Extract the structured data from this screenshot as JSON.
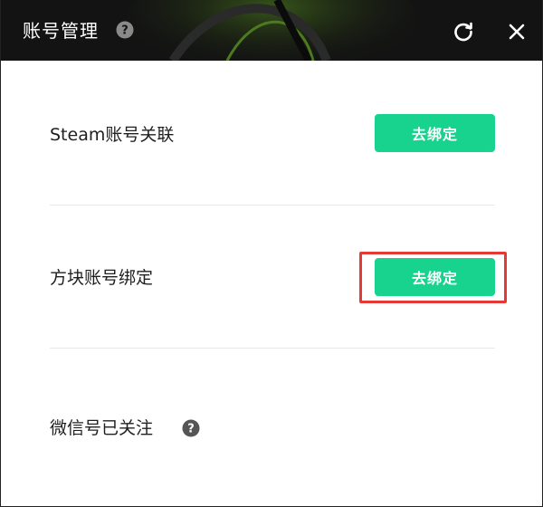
{
  "window": {
    "title": "账号管理"
  },
  "rows": [
    {
      "label": "Steam账号关联",
      "button": "去绑定"
    },
    {
      "label": "方块账号绑定",
      "button": "去绑定"
    },
    {
      "label": "微信号已关注"
    }
  ],
  "icons": {
    "title_help": "question-circle-icon",
    "refresh": "refresh-icon",
    "close": "close-icon",
    "wechat_help": "question-circle-icon"
  },
  "colors": {
    "titlebar": "#131313",
    "button": "#17d38e",
    "highlight": "#e53935",
    "text": "#1f1f1f"
  }
}
